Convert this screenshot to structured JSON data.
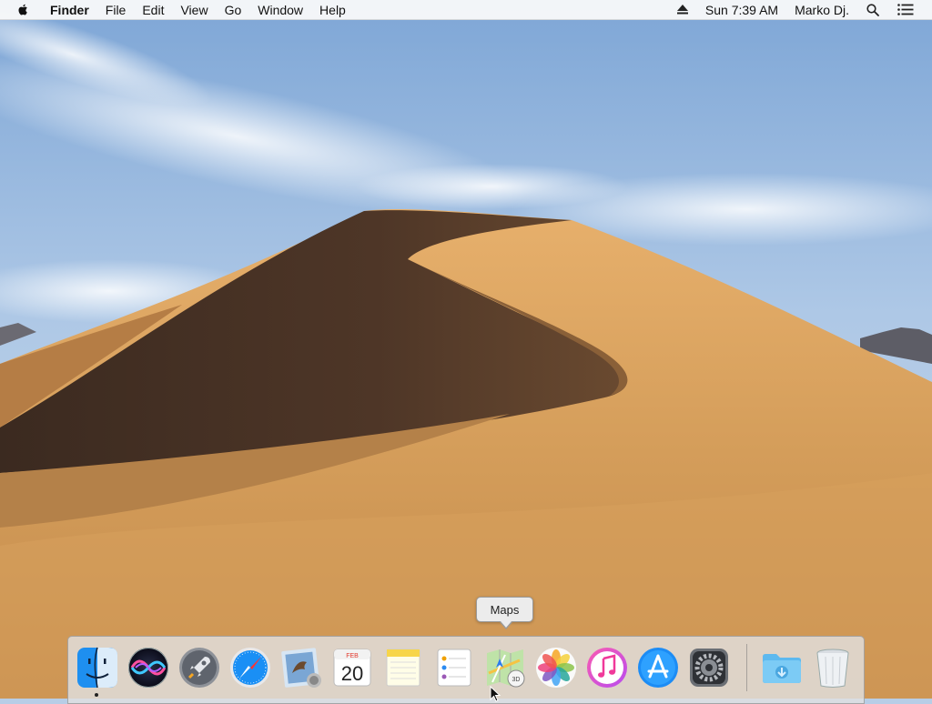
{
  "menubar": {
    "app_name": "Finder",
    "menus": [
      "File",
      "Edit",
      "View",
      "Go",
      "Window",
      "Help"
    ],
    "status": {
      "eject_icon": "eject-icon",
      "clock": "Sun 7:39 AM",
      "user": "Marko Dj.",
      "search_icon": "spotlight-search-icon",
      "notification_icon": "notification-center-icon"
    }
  },
  "tooltip": {
    "text": "Maps"
  },
  "dock": {
    "items": [
      {
        "name": "Finder",
        "icon": "finder-icon",
        "running": true
      },
      {
        "name": "Siri",
        "icon": "siri-icon"
      },
      {
        "name": "Launchpad",
        "icon": "launchpad-icon"
      },
      {
        "name": "Safari",
        "icon": "safari-icon"
      },
      {
        "name": "Mail",
        "icon": "mail-icon"
      },
      {
        "name": "Calendar",
        "icon": "calendar-icon",
        "month": "FEB",
        "day": "20"
      },
      {
        "name": "Notes",
        "icon": "notes-icon"
      },
      {
        "name": "Reminders",
        "icon": "reminders-icon"
      },
      {
        "name": "Maps",
        "icon": "maps-icon",
        "badge": "3D"
      },
      {
        "name": "Photos",
        "icon": "photos-icon"
      },
      {
        "name": "iTunes",
        "icon": "itunes-icon"
      },
      {
        "name": "App Store",
        "icon": "app-store-icon"
      },
      {
        "name": "System Preferences",
        "icon": "system-preferences-icon"
      },
      {
        "name": "Downloads",
        "icon": "downloads-folder-icon"
      },
      {
        "name": "Trash",
        "icon": "trash-icon"
      }
    ]
  },
  "colors": {
    "sky_top": "#8fb3dc",
    "sand_light": "#d9a860",
    "sand_shadow": "#4a3426",
    "dock_bg": "#e1e1e1"
  }
}
